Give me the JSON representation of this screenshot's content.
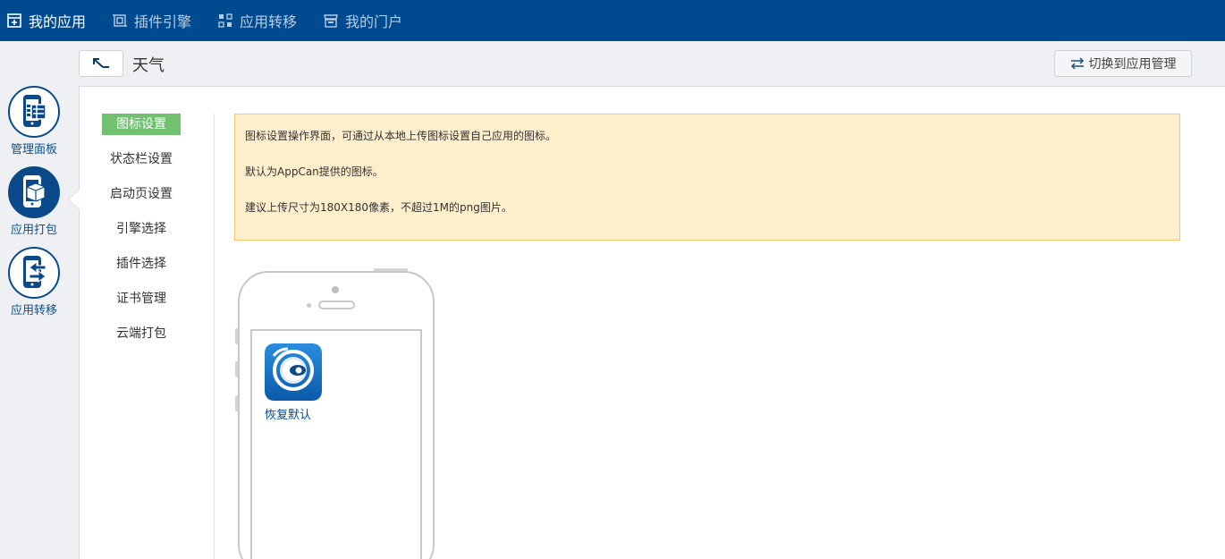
{
  "topnav": {
    "items": [
      {
        "label": "我的应用",
        "icon": "app-box-icon",
        "active": true
      },
      {
        "label": "插件引擎",
        "icon": "plugin-frame-icon",
        "active": false
      },
      {
        "label": "应用转移",
        "icon": "transfer-grid-icon",
        "active": false
      },
      {
        "label": "我的门户",
        "icon": "storefront-icon",
        "active": false
      }
    ]
  },
  "header": {
    "app_name": "天气",
    "back_icon": "arrow-up-left-icon",
    "switch_button": "切换到应用管理",
    "switch_icon": "swap-arrows-icon"
  },
  "rail": {
    "items": [
      {
        "label": "管理面板",
        "icon": "phone-dashboard-icon",
        "active": false
      },
      {
        "label": "应用打包",
        "icon": "phone-package-icon",
        "active": true
      },
      {
        "label": "应用转移",
        "icon": "phone-transfer-icon",
        "active": false
      }
    ]
  },
  "submenu": {
    "items": [
      {
        "label": "图标设置",
        "active": true
      },
      {
        "label": "状态栏设置",
        "active": false
      },
      {
        "label": "启动页设置",
        "active": false
      },
      {
        "label": "引擎选择",
        "active": false
      },
      {
        "label": "插件选择",
        "active": false
      },
      {
        "label": "证书管理",
        "active": false
      },
      {
        "label": "云端打包",
        "active": false
      }
    ]
  },
  "notice": {
    "lines": [
      "图标设置操作界面，可通过从本地上传图标设置自己应用的图标。",
      "默认为AppCan提供的图标。",
      "建议上传尺寸为180X180像素，不超过1M的png图片。"
    ]
  },
  "preview": {
    "restore_label": "恢复默认",
    "icon": "appcan-logo-icon"
  },
  "colors": {
    "topbar": "#004a8f",
    "active_submenu": "#71c171",
    "notice_bg": "#fdefcb",
    "rail_blue": "#0a4a8a"
  }
}
